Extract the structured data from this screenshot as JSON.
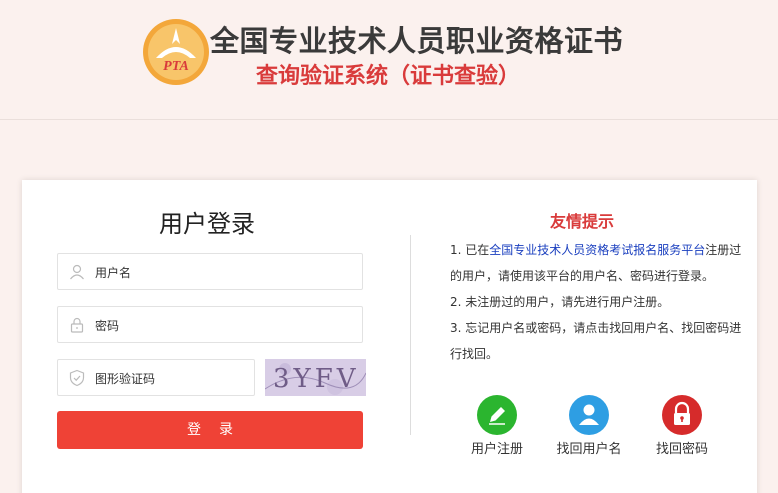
{
  "header": {
    "logo_text": "PTA",
    "title": "全国专业技术人员职业资格证书",
    "subtitle": "查询验证系统（证书查验）"
  },
  "login": {
    "title": "用户登录",
    "username_placeholder": "用户名",
    "password_placeholder": "密码",
    "captcha_placeholder": "图形验证码",
    "captcha_text": "3YFV",
    "submit_label": "登录"
  },
  "tips": {
    "title": "友情提示",
    "item1_prefix": "1. 已在",
    "item1_link": "全国专业技术人员资格考试报名服务平台",
    "item1_suffix": "注册过的用户，请使用该平台的用户名、密码进行登录。",
    "item2": "2. 未注册过的用户，请先进行用户注册。",
    "item3": "3. 忘记用户名或密码，请点击找回用户名、找回密码进行找回。"
  },
  "quick_links": {
    "register": {
      "label": "用户注册",
      "color": "#2bb52f"
    },
    "find_username": {
      "label": "找回用户名",
      "color": "#2e9ee3"
    },
    "find_password": {
      "label": "找回密码",
      "color": "#d62b2b"
    }
  },
  "colors": {
    "accent": "#ef4236",
    "title_red": "#d93b3b",
    "link_blue": "#1a3fbf"
  }
}
